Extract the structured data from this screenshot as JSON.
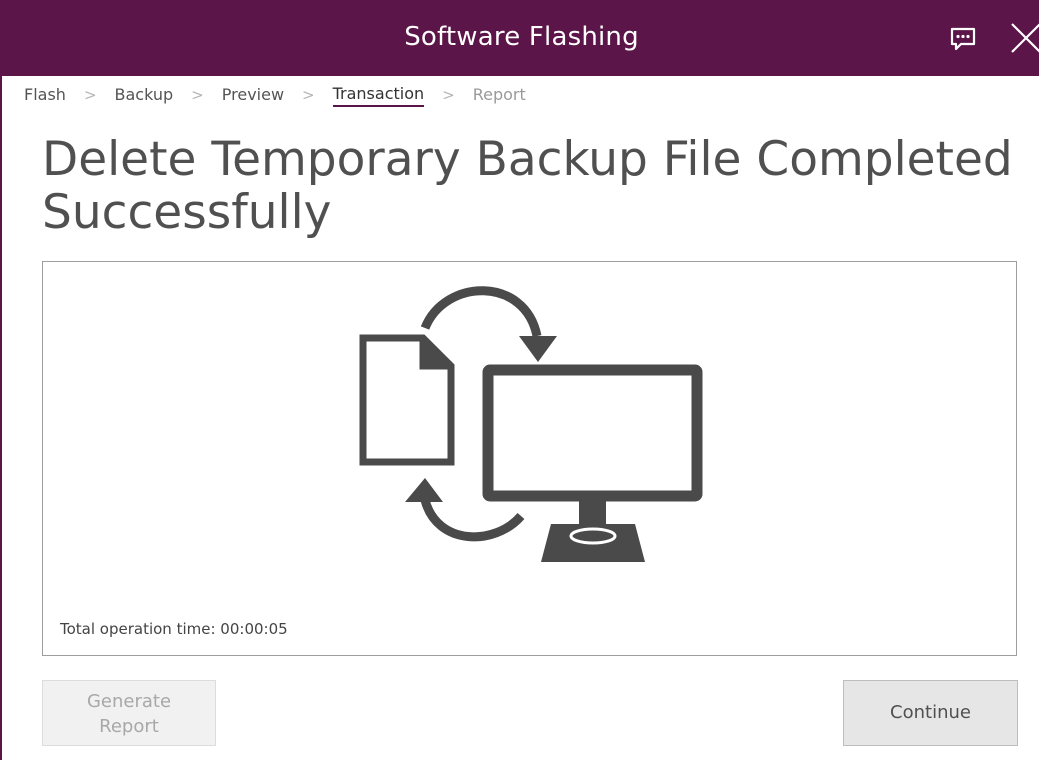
{
  "window": {
    "title": "Software Flashing"
  },
  "breadcrumb": {
    "items": [
      {
        "label": "Flash",
        "state": "completed"
      },
      {
        "label": "Backup",
        "state": "completed"
      },
      {
        "label": "Preview",
        "state": "completed"
      },
      {
        "label": "Transaction",
        "state": "active"
      },
      {
        "label": "Report",
        "state": "disabled"
      }
    ]
  },
  "main": {
    "heading": "Delete Temporary Backup File Completed Successfully",
    "operation_time": "Total operation time: 00:00:05"
  },
  "buttons": {
    "generate_report_line1": "Generate",
    "generate_report_line2": "Report",
    "generate_report_enabled": false,
    "continue": "Continue"
  },
  "colors": {
    "titlebar": "#5b1548",
    "icon": "#4a4a4a",
    "disabled_text": "#a8a8a8"
  },
  "icons": {
    "feedback": "chat-bubble-icon",
    "close": "close-icon",
    "illustration": "file-to-computer-sync-icon"
  }
}
